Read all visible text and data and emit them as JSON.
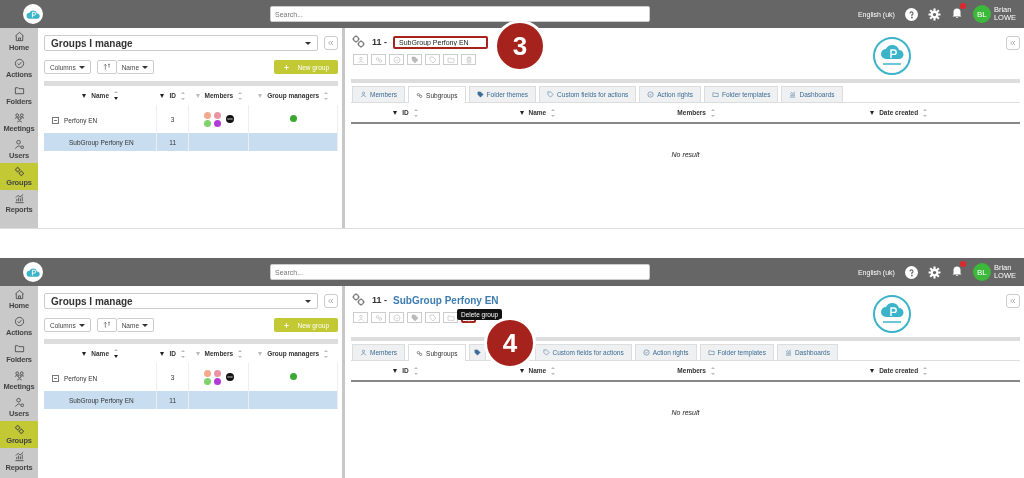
{
  "screens": [
    {
      "search": {
        "placeholder": "Search..."
      },
      "language": "English (uk)",
      "user": {
        "initials": "BL",
        "first_name": "Brian",
        "last_name": "LOWE"
      },
      "nav": [
        {
          "label": "Home",
          "selected": false
        },
        {
          "label": "Actions",
          "selected": false
        },
        {
          "label": "Folders",
          "selected": false
        },
        {
          "label": "Meetings",
          "selected": false
        },
        {
          "label": "Users",
          "selected": false
        },
        {
          "label": "Groups",
          "selected": true
        },
        {
          "label": "Reports",
          "selected": false
        }
      ],
      "group_select": "Groups I manage",
      "columns_button": "Columns",
      "sort_button": "Name",
      "new_group_button": "New group",
      "columns": [
        "Name",
        "ID",
        "Members",
        "Group managers"
      ],
      "rows": [
        {
          "name": "Perfony EN",
          "id": "3",
          "expanded": true,
          "selected": false,
          "members": [
            {
              "color": "#f4a98c"
            },
            {
              "color": "#ea94a6"
            },
            {
              "color": "#7fd26c"
            },
            {
              "color": "#b23ad8"
            }
          ],
          "managers": [
            {
              "color": "#3aa832"
            }
          ],
          "children": [
            {
              "name": "SubGroup Perfony EN",
              "id": "11",
              "selected": true
            }
          ]
        }
      ],
      "group_number": "11 -",
      "title": {
        "kind": "field",
        "value": "SubGroup Perfony EN",
        "highlighted": true
      },
      "toolbar": [
        {
          "highlighted": false
        },
        {
          "highlighted": false
        },
        {
          "highlighted": false
        },
        {
          "highlighted": false
        },
        {
          "highlighted": false
        },
        {
          "highlighted": false
        },
        {
          "highlighted": false
        }
      ],
      "tabs": [
        {
          "label": "Members",
          "selected": false
        },
        {
          "label": "Subgroups",
          "selected": true
        },
        {
          "label": "Folder themes",
          "selected": false
        },
        {
          "label": "Custom fields for actions",
          "selected": false
        },
        {
          "label": "Action rights",
          "selected": false
        },
        {
          "label": "Folder templates",
          "selected": false
        },
        {
          "label": "Dashboards",
          "selected": false
        }
      ],
      "detail_columns": [
        "ID",
        "Name",
        "Members",
        "Date created"
      ],
      "empty_text": "No result",
      "callout": {
        "number": "3"
      }
    },
    {
      "search": {
        "placeholder": "Search..."
      },
      "language": "English (uk)",
      "user": {
        "initials": "BL",
        "first_name": "Brian",
        "last_name": "LOWE"
      },
      "nav": [
        {
          "label": "Home",
          "selected": false
        },
        {
          "label": "Actions",
          "selected": false
        },
        {
          "label": "Folders",
          "selected": false
        },
        {
          "label": "Meetings",
          "selected": false
        },
        {
          "label": "Users",
          "selected": false
        },
        {
          "label": "Groups",
          "selected": true
        },
        {
          "label": "Reports",
          "selected": false
        }
      ],
      "group_select": "Groups I manage",
      "columns_button": "Columns",
      "sort_button": "Name",
      "new_group_button": "New group",
      "columns": [
        "Name",
        "ID",
        "Members",
        "Group managers"
      ],
      "rows": [
        {
          "name": "Perfony EN",
          "id": "3",
          "expanded": true,
          "selected": false,
          "members": [
            {
              "color": "#f4a98c"
            },
            {
              "color": "#ea94a6"
            },
            {
              "color": "#7fd26c"
            },
            {
              "color": "#b23ad8"
            }
          ],
          "managers": [
            {
              "color": "#3aa832"
            }
          ],
          "children": [
            {
              "name": "SubGroup Perfony EN",
              "id": "11",
              "selected": true
            }
          ]
        }
      ],
      "group_number": "11 -",
      "title": {
        "kind": "link",
        "value": "SubGroup Perfony EN",
        "highlighted": false
      },
      "toolbar": [
        {
          "highlighted": false
        },
        {
          "highlighted": false
        },
        {
          "highlighted": false
        },
        {
          "highlighted": false
        },
        {
          "highlighted": false
        },
        {
          "highlighted": false
        },
        {
          "highlighted": true
        }
      ],
      "tooltip": "Delete group",
      "tabs": [
        {
          "label": "Members",
          "selected": false
        },
        {
          "label": "Subgroups",
          "selected": true
        },
        {
          "selected": false
        },
        {
          "label": "Custom fields for actions",
          "selected": false
        },
        {
          "label": "Action rights",
          "selected": false
        },
        {
          "label": "Folder templates",
          "selected": false
        },
        {
          "label": "Dashboards",
          "selected": false
        }
      ],
      "detail_columns": [
        "ID",
        "Name",
        "Members",
        "Date created"
      ],
      "empty_text": "No result",
      "callout": {
        "number": "4"
      }
    }
  ]
}
